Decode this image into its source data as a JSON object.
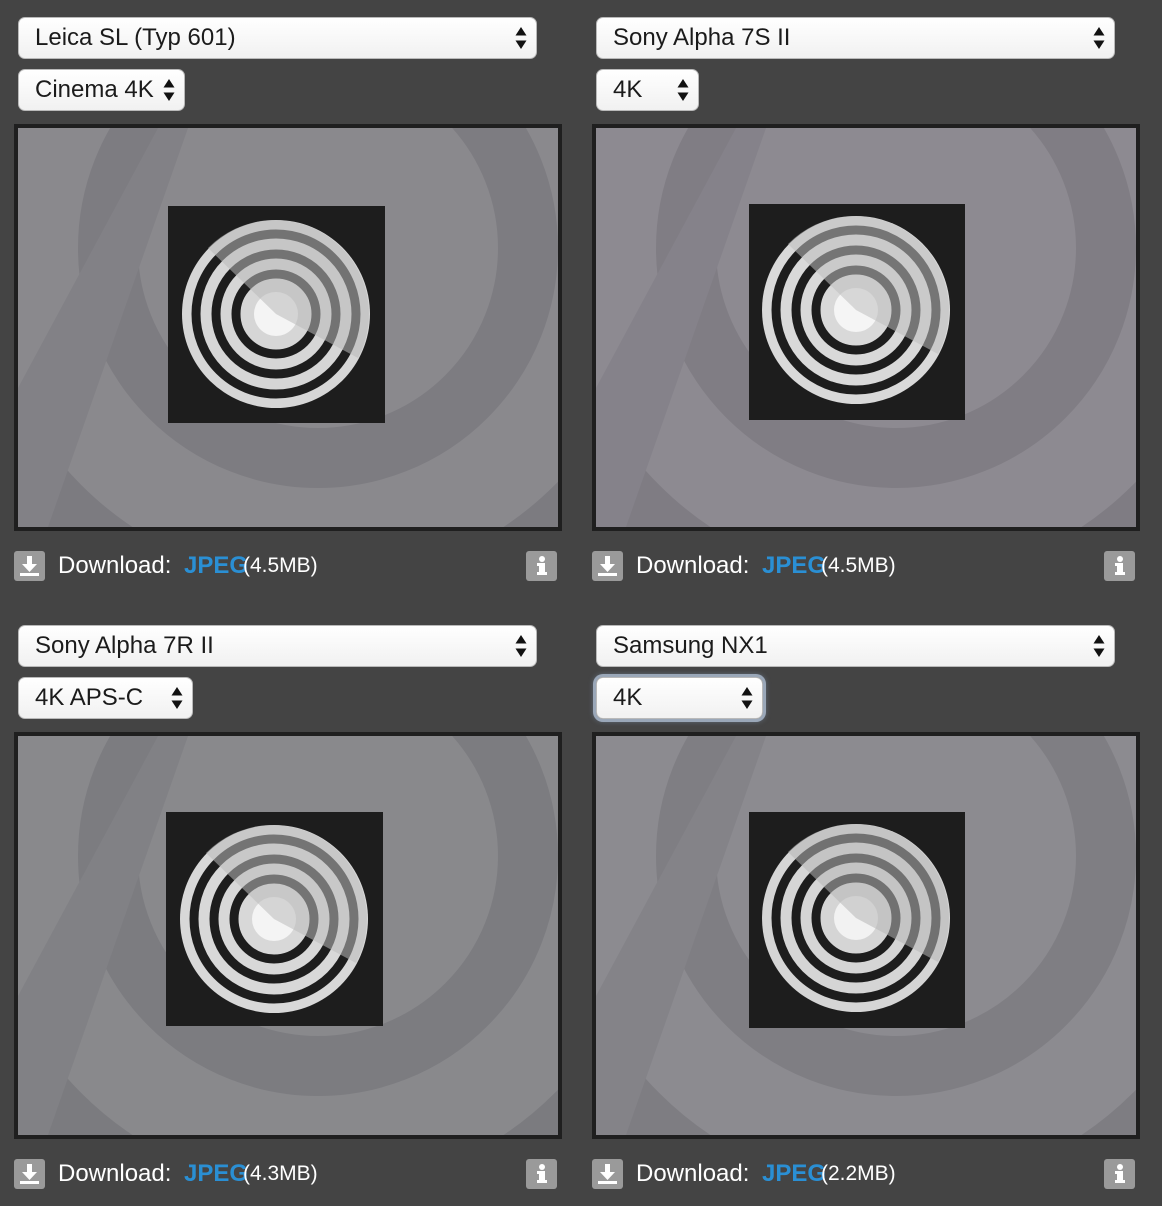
{
  "panels": [
    {
      "camera": "Leica SL (Typ 601)",
      "mode": "Cinema 4K",
      "download_label": "Download:",
      "link_label": "JPEG",
      "size": "(4.5MB)",
      "sample_alt": "Leica SL (Typ 601) Cinema 4K test chart crop"
    },
    {
      "camera": "Sony Alpha 7S II",
      "mode": "4K",
      "download_label": "Download:",
      "link_label": "JPEG",
      "size": "(4.5MB)",
      "sample_alt": "Sony Alpha 7S II 4K test chart crop"
    },
    {
      "camera": "Sony Alpha 7R II",
      "mode": "4K APS-C",
      "download_label": "Download:",
      "link_label": "JPEG",
      "size": "(4.3MB)",
      "sample_alt": "Sony Alpha 7R II 4K APS-C test chart crop"
    },
    {
      "camera": "Samsung NX1",
      "mode": "4K",
      "download_label": "Download:",
      "link_label": "JPEG",
      "size": "(2.2MB)",
      "sample_alt": "Samsung NX1 4K test chart crop"
    }
  ],
  "icons": {
    "download": "download-icon",
    "info": "info-icon",
    "select_arrows": "select-arrows-icon"
  },
  "colors": {
    "background": "#444444",
    "link": "#2a8fd4",
    "icon_bg": "#9a9a9a"
  }
}
